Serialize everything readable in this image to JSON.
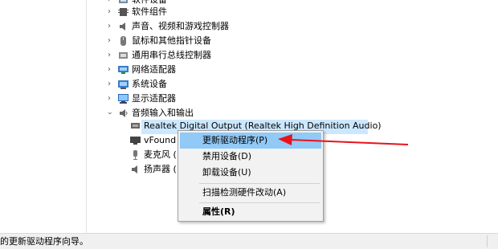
{
  "tree": {
    "items": [
      {
        "label": "软件设备",
        "icon": "software-device-icon",
        "expanded": false
      },
      {
        "label": "软件组件",
        "icon": "software-component-icon",
        "expanded": false
      },
      {
        "label": "声音、视频和游戏控制器",
        "icon": "speaker-icon",
        "expanded": false
      },
      {
        "label": "鼠标和其他指针设备",
        "icon": "mouse-icon",
        "expanded": false
      },
      {
        "label": "通用串行总线控制器",
        "icon": "usb-icon",
        "expanded": false
      },
      {
        "label": "网络适配器",
        "icon": "network-adapter-icon",
        "expanded": false
      },
      {
        "label": "系统设备",
        "icon": "system-device-icon",
        "expanded": false
      },
      {
        "label": "显示适配器",
        "icon": "display-adapter-icon",
        "expanded": false
      },
      {
        "label": "音频输入和输出",
        "icon": "audio-io-icon",
        "expanded": true
      }
    ],
    "children": [
      {
        "label": "Realtek Digital Output (Realtek High Definition Audio)",
        "icon": "audio-device-icon",
        "selected": true
      },
      {
        "label": "vFound",
        "icon": "monitor-audio-icon",
        "selected": false
      },
      {
        "label": "麦克风 (",
        "icon": "microphone-icon",
        "selected": false
      },
      {
        "label": "扬声器 (",
        "icon": "speaker-device-icon",
        "selected": false
      }
    ]
  },
  "context_menu": {
    "items": [
      {
        "label": "更新驱动程序(P)",
        "highlighted": true
      },
      {
        "label": "禁用设备(D)"
      },
      {
        "label": "卸载设备(U)"
      },
      {
        "label": "扫描检测硬件改动(A)"
      },
      {
        "label": "属性(R)",
        "bold": true
      }
    ]
  },
  "status_bar": {
    "text": "的更新驱动程序向导。"
  },
  "annotation": {
    "color": "#e8131b"
  }
}
